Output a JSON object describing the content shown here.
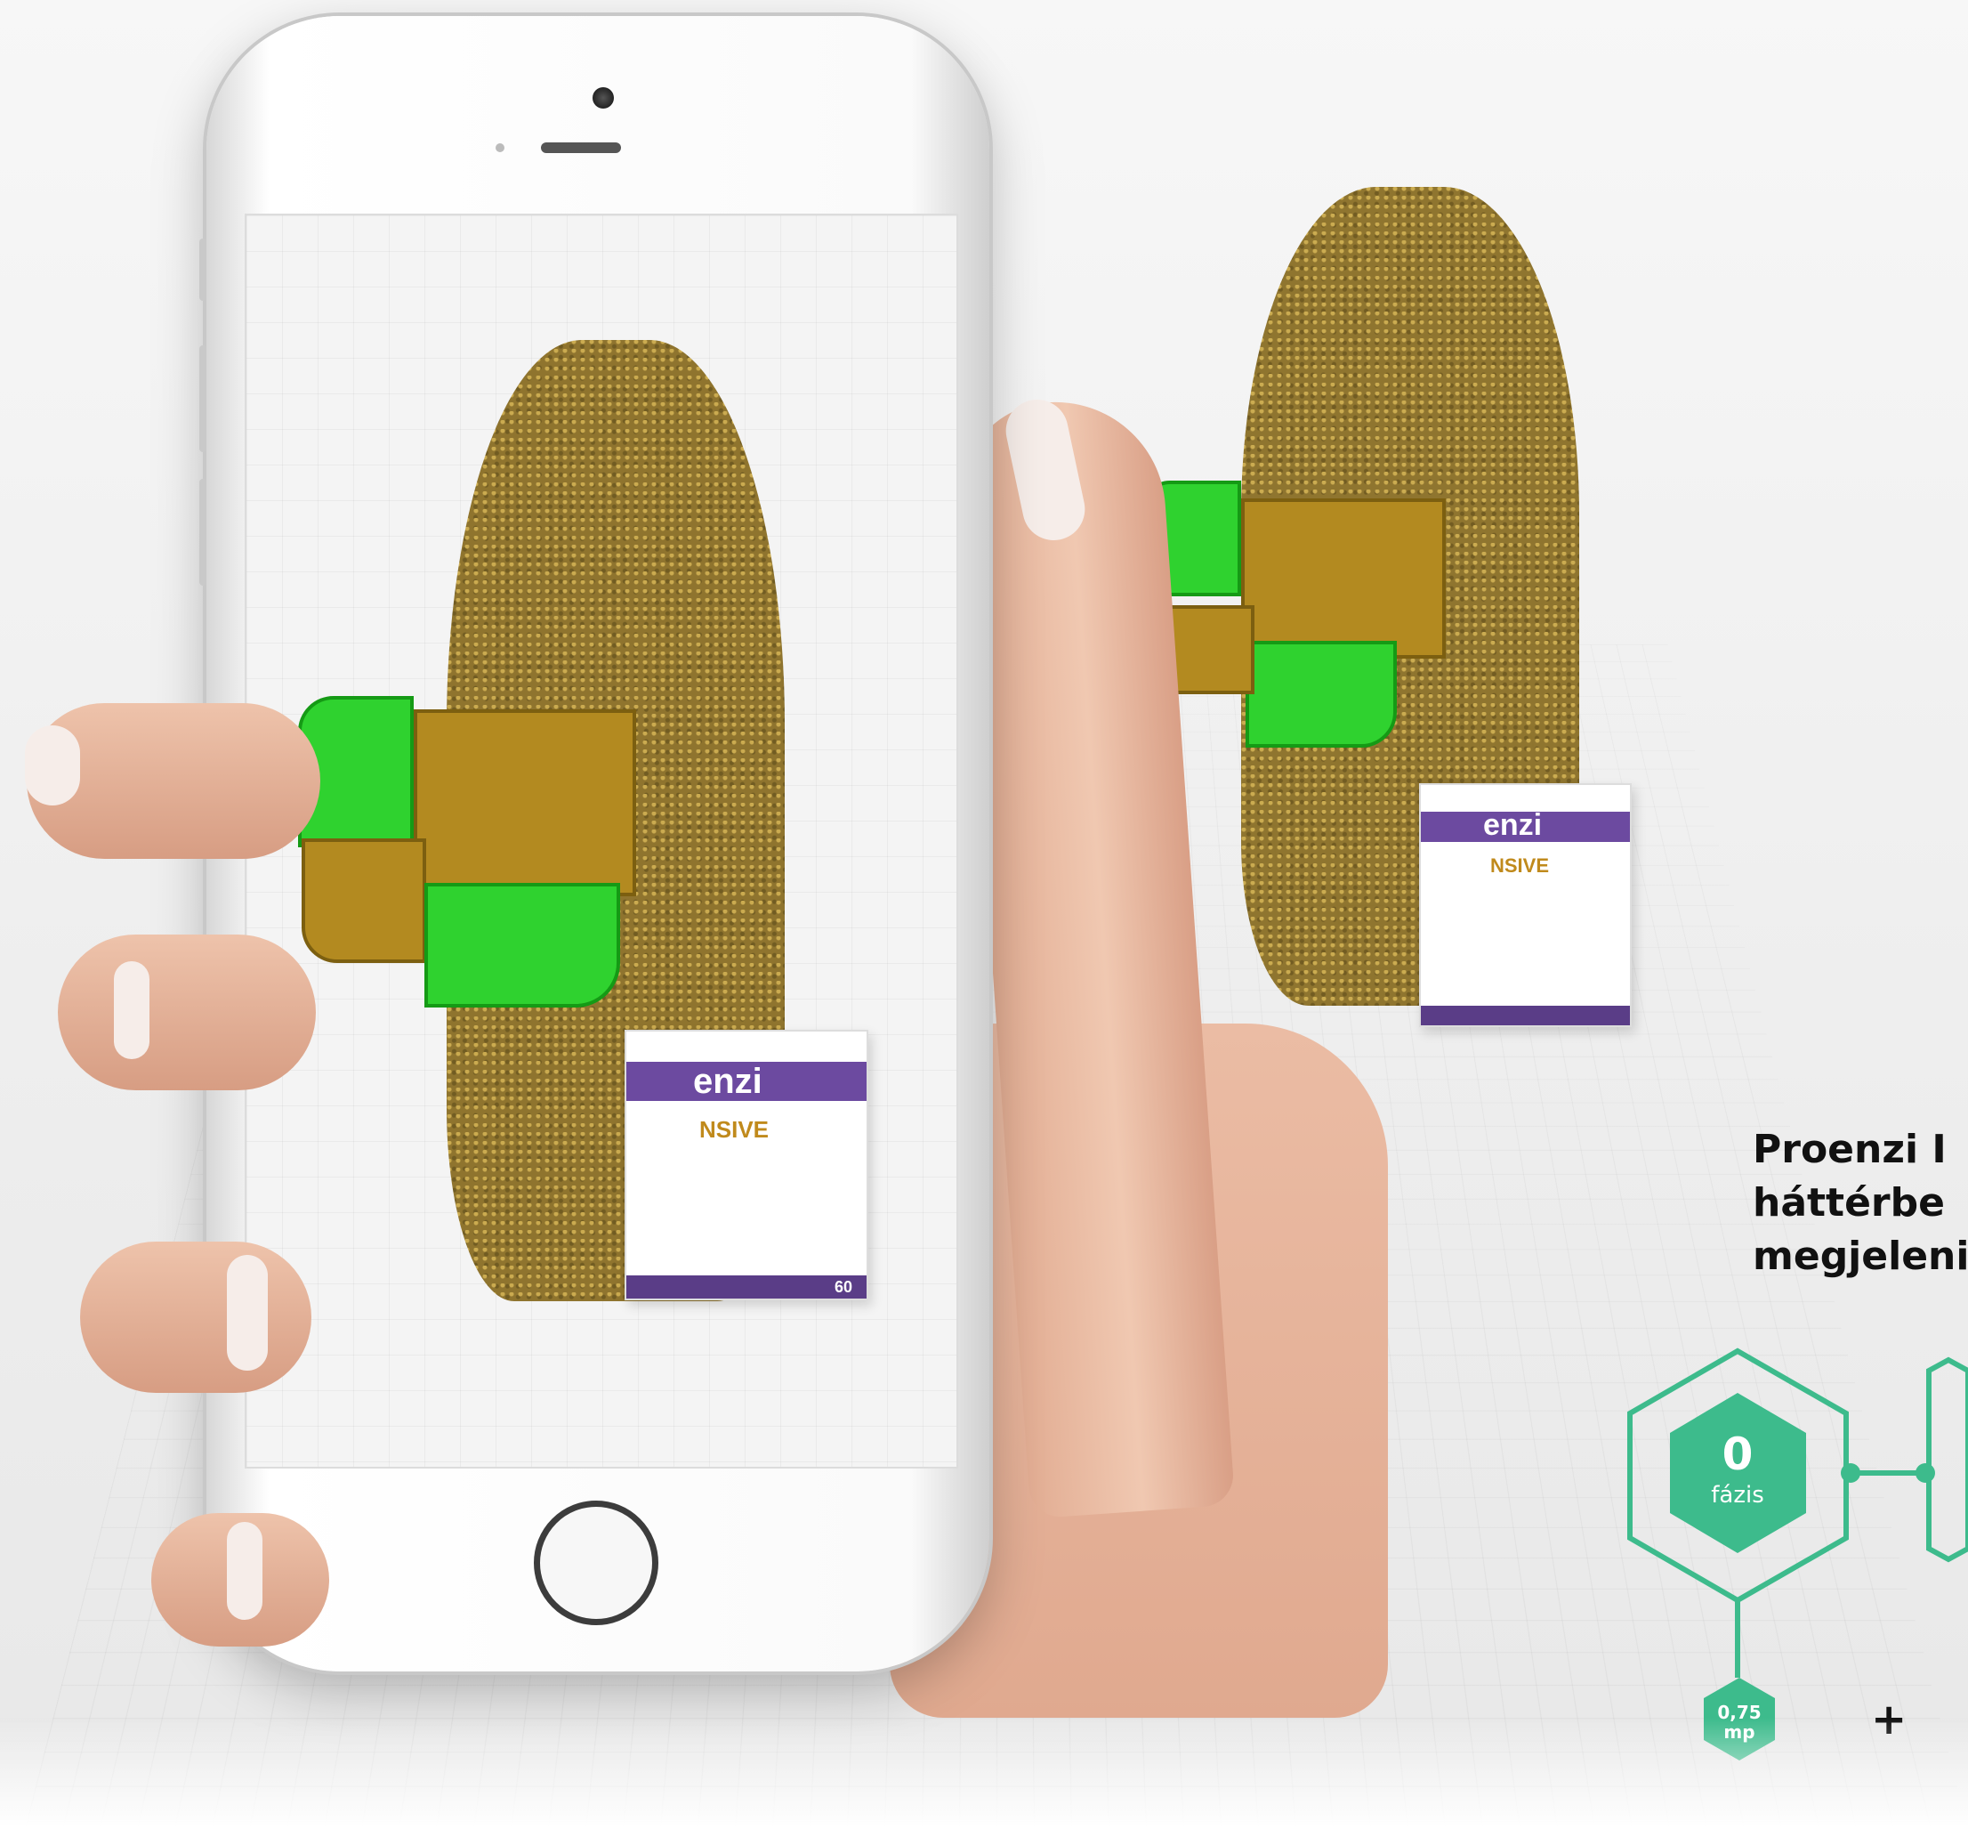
{
  "caption": {
    "line1": "Proenzi  I",
    "line2": "háttérbe",
    "line3": "megjeleni"
  },
  "product": {
    "brand": "enzi",
    "variant": "NSIVE",
    "count": "60"
  },
  "diagram": {
    "phase_number": "0",
    "phase_label": "fázis",
    "time_value": "0,75",
    "time_unit": "mp",
    "operator": "+"
  },
  "colors": {
    "accent": "#3dbb8c",
    "figure_gold": "#8a6e24",
    "box_green": "#2fd22f",
    "product_purple": "#5a3d87"
  },
  "icons": {
    "camera": "camera-icon",
    "home_button": "home-button-icon"
  }
}
